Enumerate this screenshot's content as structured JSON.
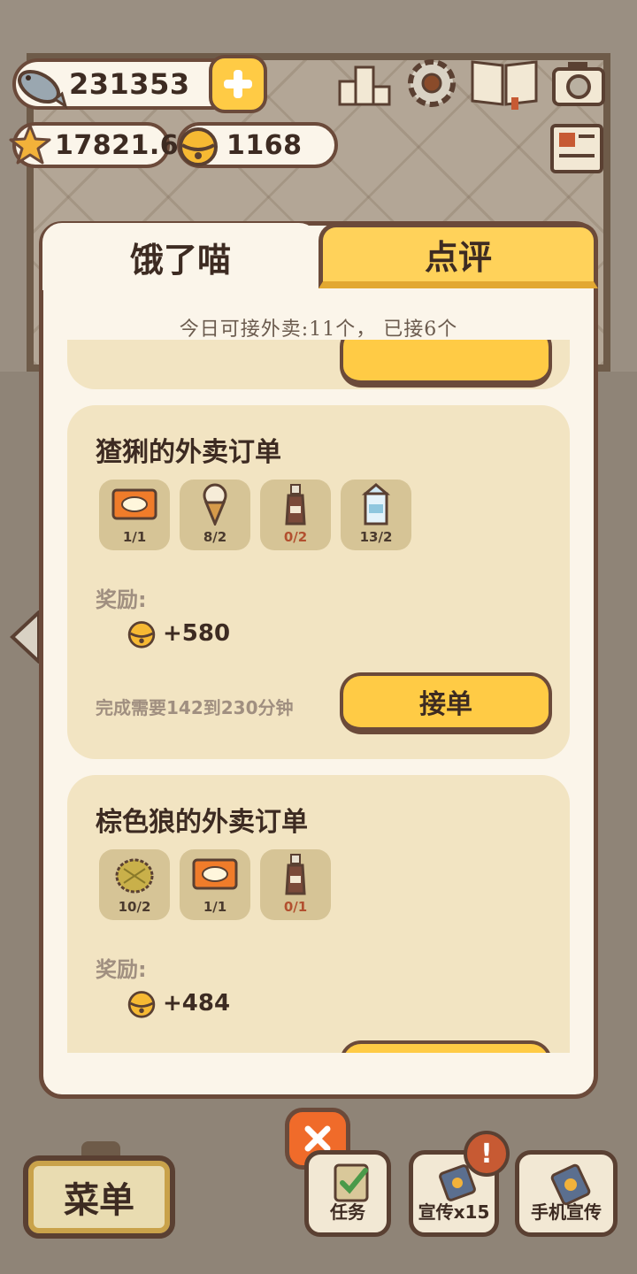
{
  "hud": {
    "fish_count": "231353",
    "star_rating": "17821.6",
    "bell_count": "1168"
  },
  "top_icons": [
    "ranking-icon",
    "gear-icon",
    "book-icon",
    "camera-icon",
    "newspaper-icon"
  ],
  "tabs": [
    {
      "label": "饿了喵",
      "active": true
    },
    {
      "label": "点评",
      "active": false
    }
  ],
  "quota_text": "今日可接外卖:11个， 已接6个",
  "orders": [
    {
      "title": "猹猁的外卖订单",
      "items": [
        {
          "icon": "rice-tray-icon",
          "count": "1/1",
          "short": false
        },
        {
          "icon": "ice-cream-icon",
          "count": "8/2",
          "short": false
        },
        {
          "icon": "soda-bottle-icon",
          "count": "0/2",
          "short": true
        },
        {
          "icon": "milk-carton-icon",
          "count": "13/2",
          "short": false
        }
      ],
      "reward_label": "奖励:",
      "reward": "+580",
      "duration": "完成需要142到230分钟",
      "accept_label": "接单"
    },
    {
      "title": "棕色狼的外卖订单",
      "items": [
        {
          "icon": "durian-icon",
          "count": "10/2",
          "short": false
        },
        {
          "icon": "rice-tray-icon",
          "count": "1/1",
          "short": false
        },
        {
          "icon": "soda-bottle-icon",
          "count": "0/1",
          "short": true
        }
      ],
      "reward_label": "奖励:",
      "reward": "+484"
    }
  ],
  "bottom": {
    "menu_label": "菜单",
    "tasks_label": "任务",
    "promo_label": "宣传x15",
    "phone_promo_label": "手机宣传",
    "alert": "!"
  },
  "colors": {
    "accent_yellow": "#ffcb45",
    "outline_brown": "#6b4a3a",
    "card_bg": "#f2e4c2",
    "panel_bg": "#fbf5ea",
    "close_orange": "#f06b2a"
  }
}
